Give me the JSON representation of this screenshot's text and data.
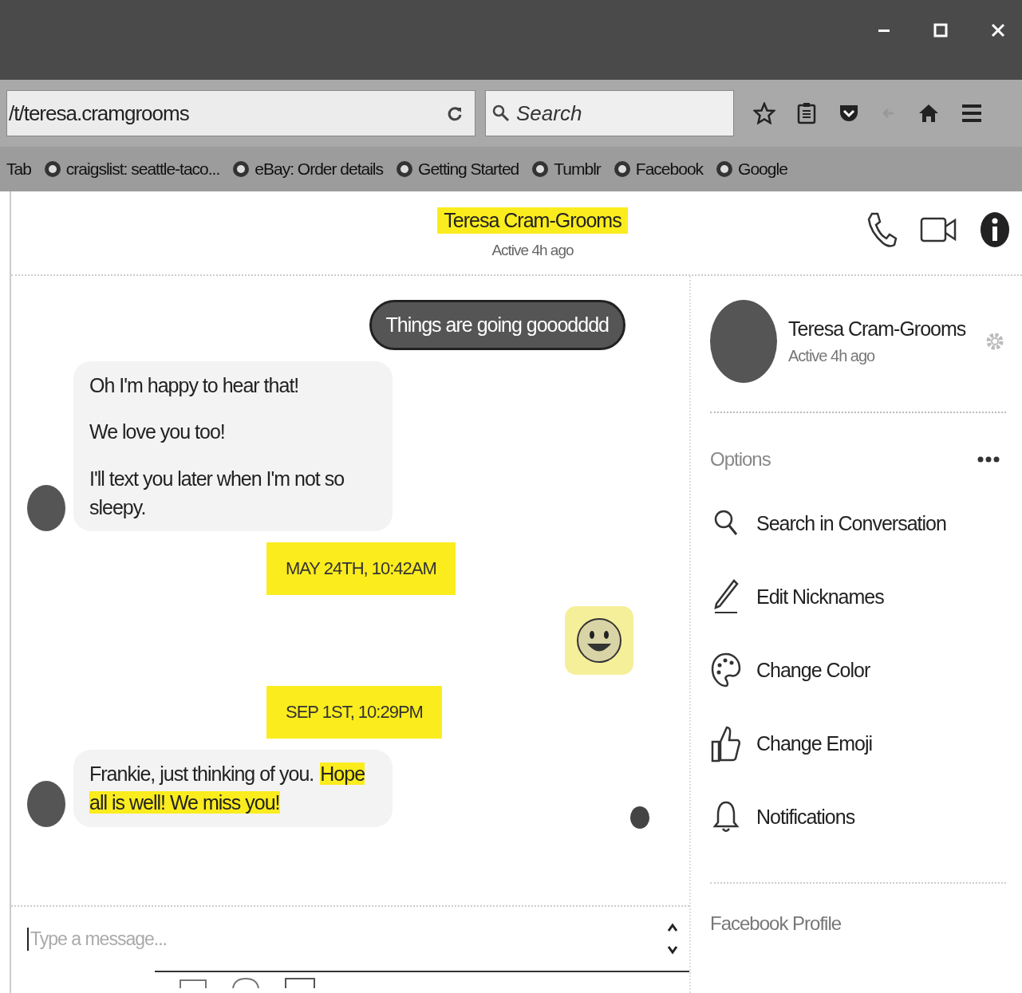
{
  "browser": {
    "url": "/t/teresa.cramgrooms",
    "search_placeholder": "Search",
    "bookmarks": [
      {
        "label": "Tab",
        "kind": "plain"
      },
      {
        "label": "craigslist: seattle-taco...",
        "kind": "site"
      },
      {
        "label": "eBay: Order details",
        "kind": "site"
      },
      {
        "label": "Getting Started",
        "kind": "site"
      },
      {
        "label": "Tumblr",
        "kind": "site"
      },
      {
        "label": "Facebook",
        "kind": "site"
      },
      {
        "label": "Google",
        "kind": "site"
      }
    ]
  },
  "conversation": {
    "name": "Teresa Cram-Grooms",
    "highlighted": true,
    "status": "Active 4h ago"
  },
  "messages": [
    {
      "kind": "sent",
      "text": "Things are going gooodddd"
    },
    {
      "kind": "received",
      "paragraphs": [
        [
          {
            "text": "Oh I'm happy to hear that!",
            "highlighted": false
          }
        ],
        [
          {
            "text": "We love you too!",
            "highlighted": false
          }
        ],
        [
          {
            "text": "I'll text you later when I'm not so sleepy.",
            "highlighted": false
          }
        ]
      ]
    },
    {
      "kind": "timestamp",
      "text": "MAY 24TH, 10:42AM",
      "highlighted": true
    },
    {
      "kind": "emoji",
      "highlighted": true
    },
    {
      "kind": "timestamp",
      "text": "SEP 1ST, 10:29PM",
      "highlighted": true
    },
    {
      "kind": "received",
      "paragraphs": [
        [
          {
            "text": "Frankie, just thinking of you.",
            "highlighted": false
          },
          {
            "text": "Hope all is well!  We miss you!",
            "highlighted": true
          }
        ]
      ]
    }
  ],
  "composer": {
    "placeholder": "Type a message..."
  },
  "profile": {
    "name": "Teresa Cram-Grooms",
    "status": "Active 4h ago"
  },
  "options": {
    "title": "Options",
    "items": [
      {
        "label": "Search in Conversation",
        "kind": "search"
      },
      {
        "label": "Edit Nicknames",
        "kind": "edit"
      },
      {
        "label": "Change Color",
        "kind": "color"
      },
      {
        "label": "Change Emoji",
        "kind": "emoji"
      },
      {
        "label": "Notifications",
        "kind": "notifications"
      }
    ]
  },
  "footer_link": "Facebook Profile"
}
